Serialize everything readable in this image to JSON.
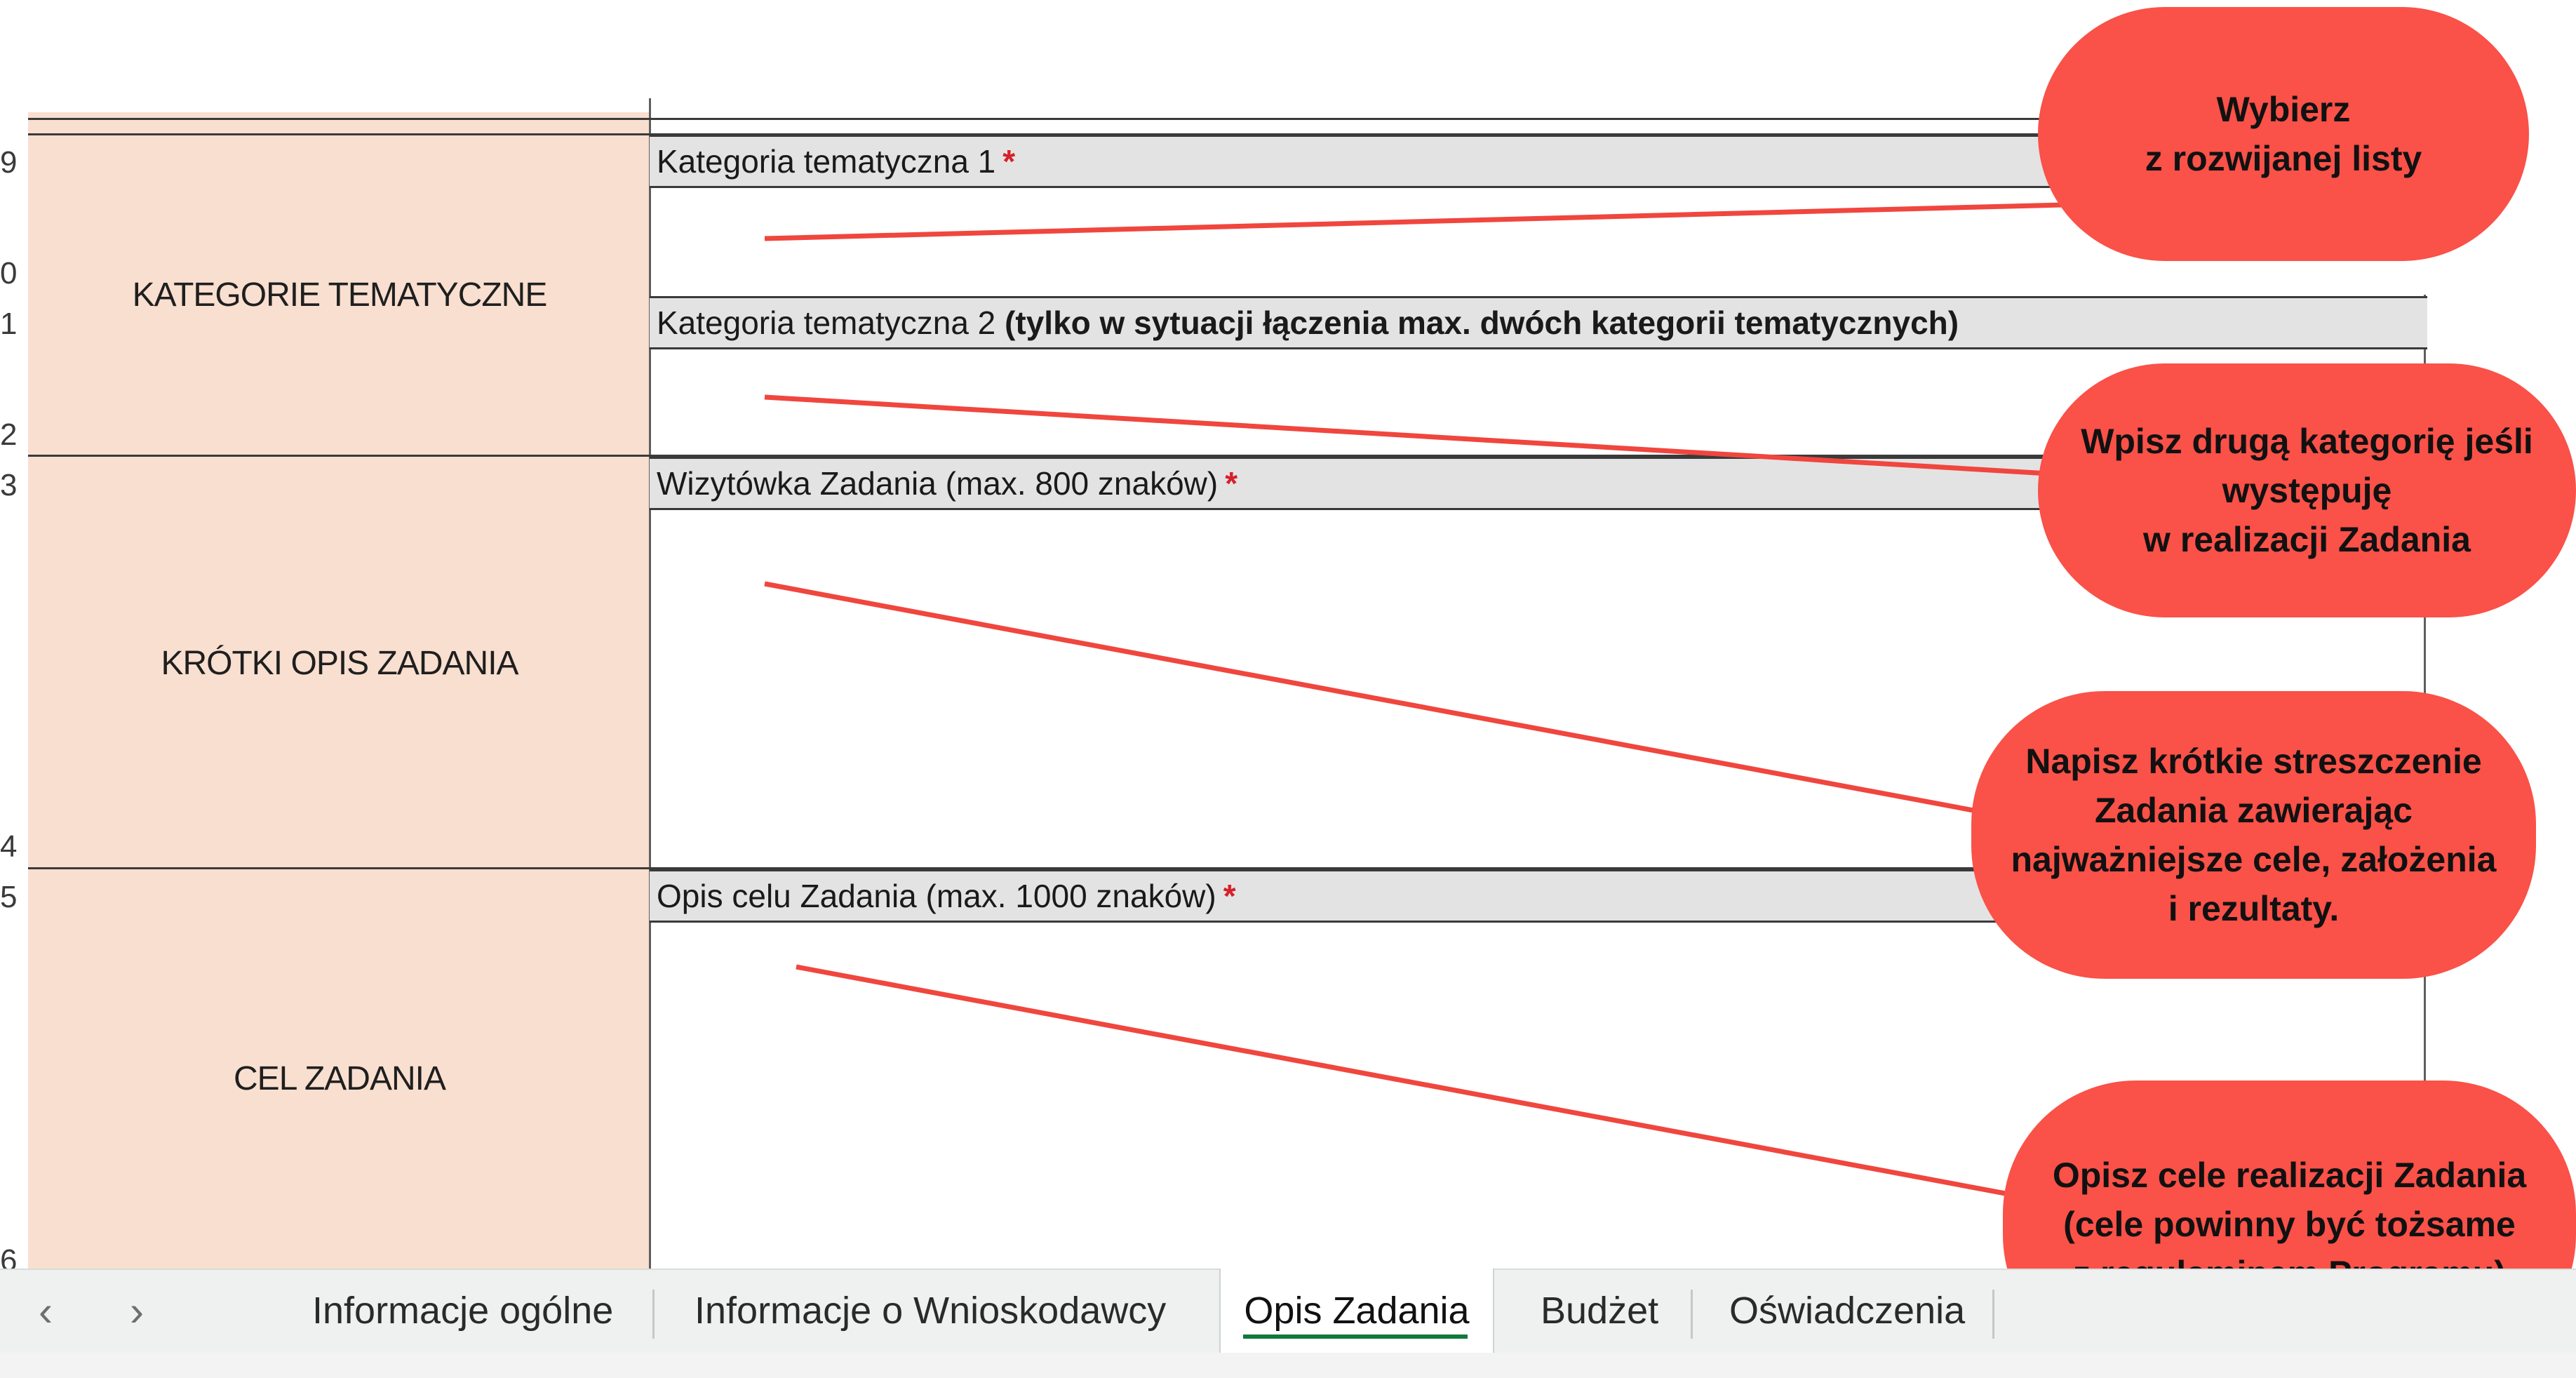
{
  "row_numbers": [
    "9",
    "0",
    "1",
    "2",
    "3",
    "4",
    "5",
    "6"
  ],
  "sections": [
    {
      "label": "KATEGORIE TEMATYCZNE"
    },
    {
      "label": "KRÓTKI OPIS ZADANIA"
    },
    {
      "label": "CEL ZADANIA"
    }
  ],
  "fields": {
    "category1": {
      "label": "Kategoria tematyczna 1",
      "required": "*"
    },
    "category2": {
      "label": "Kategoria tematyczna 2",
      "note": "(tylko w sytuacji łączenia max. dwóch kategorii tematycznych)"
    },
    "card": {
      "label": "Wizytówka Zadania (max. 800 znaków)",
      "required": "*"
    },
    "goal": {
      "label": "Opis celu Zadania (max. 1000 znaków)",
      "required": "*"
    }
  },
  "callouts": [
    {
      "text": "Wybierz\nz rozwijanej listy"
    },
    {
      "text": "Wpisz drugą kategorię jeśli\nwystępuję\nw realizacji Zadania"
    },
    {
      "text": "Napisz krótkie streszczenie\nZadania zawierając\nnajważniejsze cele, założenia\ni rezultaty."
    },
    {
      "text": "Opisz cele realizacji Zadania\n(cele powinny być tożsame\nz regulaminem Programu)"
    }
  ],
  "tabs": [
    {
      "label": "Informacje ogólne",
      "active": false
    },
    {
      "label": "Informacje o Wnioskodawcy",
      "active": false
    },
    {
      "label": "Opis Zadania",
      "active": true
    },
    {
      "label": "Budżet",
      "active": false
    },
    {
      "label": "Oświadczenia",
      "active": false
    }
  ],
  "nav": {
    "prev": "‹",
    "next": "›"
  },
  "colors": {
    "callout": "#fa5148",
    "section_fill": "#f9dfd0",
    "header_fill": "#e3e3e3",
    "active_tab_underline": "#0e7a3c",
    "required": "#d6202a"
  }
}
